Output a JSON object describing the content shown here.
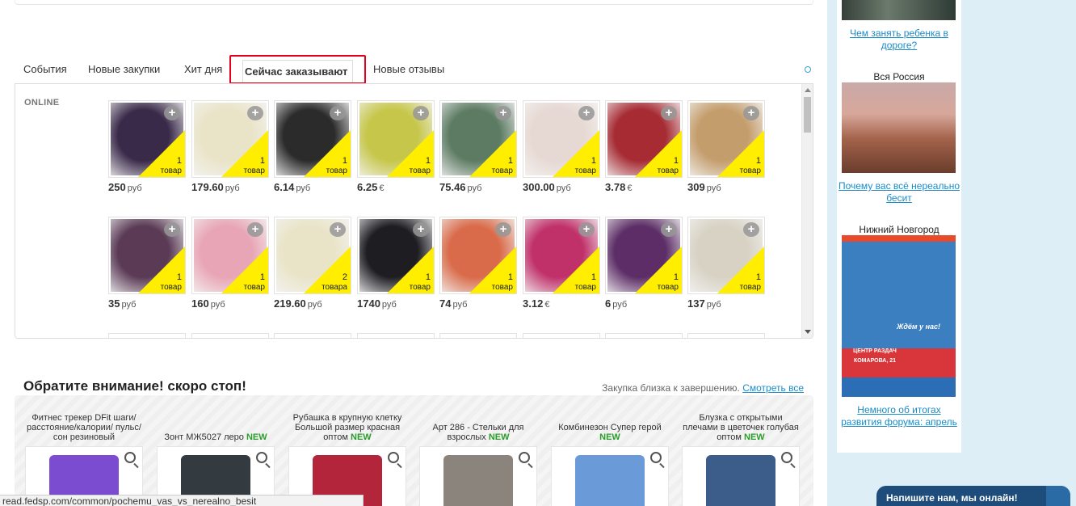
{
  "tabs": [
    {
      "label": "События"
    },
    {
      "label": "Новые закупки"
    },
    {
      "label": "Хит дня"
    },
    {
      "label": "Сейчас заказывают"
    },
    {
      "label": "Новые отзывы"
    }
  ],
  "panel": {
    "online_label": "ONLINE",
    "items": [
      {
        "price": "250",
        "currency": "руб",
        "qty": "1",
        "unit": "товар",
        "color": "#3a2a4a"
      },
      {
        "price": "179.60",
        "currency": "руб",
        "qty": "1",
        "unit": "товар",
        "color": "#e9e4c8"
      },
      {
        "price": "6.14",
        "currency": "руб",
        "qty": "1",
        "unit": "товар",
        "color": "#2b2b2b"
      },
      {
        "price": "6.25",
        "currency": "€",
        "qty": "1",
        "unit": "товар",
        "color": "#c6c64a"
      },
      {
        "price": "75.46",
        "currency": "руб",
        "qty": "1",
        "unit": "товар",
        "color": "#5d7b63"
      },
      {
        "price": "300.00",
        "currency": "руб",
        "qty": "1",
        "unit": "товар",
        "color": "#e6d8d2"
      },
      {
        "price": "3.78",
        "currency": "€",
        "qty": "1",
        "unit": "товар",
        "color": "#a62b33"
      },
      {
        "price": "309",
        "currency": "руб",
        "qty": "1",
        "unit": "товар",
        "color": "#c49d6c"
      },
      {
        "price": "35",
        "currency": "руб",
        "qty": "1",
        "unit": "товар",
        "color": "#5a3a55"
      },
      {
        "price": "160",
        "currency": "руб",
        "qty": "1",
        "unit": "товар",
        "color": "#e8a5b5"
      },
      {
        "price": "219.60",
        "currency": "руб",
        "qty": "2",
        "unit": "товара",
        "color": "#e9e4c8"
      },
      {
        "price": "1740",
        "currency": "руб",
        "qty": "1",
        "unit": "товар",
        "color": "#1d1d22"
      },
      {
        "price": "74",
        "currency": "руб",
        "qty": "1",
        "unit": "товар",
        "color": "#d96b4a"
      },
      {
        "price": "3.12",
        "currency": "€",
        "qty": "1",
        "unit": "товар",
        "color": "#c0316a"
      },
      {
        "price": "6",
        "currency": "руб",
        "qty": "1",
        "unit": "товар",
        "color": "#5c2d66"
      },
      {
        "price": "137",
        "currency": "руб",
        "qty": "1",
        "unit": "товар",
        "color": "#d8d2c4"
      }
    ]
  },
  "attention": {
    "title": "Обратите внимание! скоро стоп!",
    "note": "Закупка близка к завершению.",
    "link": "Смотреть все",
    "cards": [
      {
        "title": "Фитнес трекер DFit шаги/ расстояние/калории/ пульс/сон резиновый",
        "new": "",
        "color": "#7b4bd0"
      },
      {
        "title": "Зонт МЖ5027 леро",
        "new": "NEW",
        "color": "#333a40"
      },
      {
        "title": "Рубашка в крупную клетку Большой размер красная оптом",
        "new": "NEW",
        "color": "#b3253a"
      },
      {
        "title": "Арт 286 - Стельки для взрослых",
        "new": "NEW",
        "color": "#8a847c"
      },
      {
        "title": "Комбинезон Супер герой",
        "new": "NEW",
        "color": "#6a9ad8"
      },
      {
        "title": "Блузка с открытыми плечами в цветочек голубая оптом",
        "new": "NEW",
        "color": "#3c5c8a"
      }
    ]
  },
  "right": {
    "link1": "Чем занять ребенка в дороге?",
    "city1": "Вся Россия",
    "link2": "Почему вас всё нереально бесит",
    "city2": "Нижний Новгород",
    "poster_line1": "Ждём у нас!",
    "poster_line2": "ЦЕНТР РАЗДАЧ",
    "poster_line3": "КОМАРОВА, 21",
    "link3": "Немного об итогах развития форума: апрель"
  },
  "statusbar": "read.fedsp.com/common/pochemu_vas_vs_nerealno_besit",
  "chat": "Напишите нам, мы онлайн!"
}
